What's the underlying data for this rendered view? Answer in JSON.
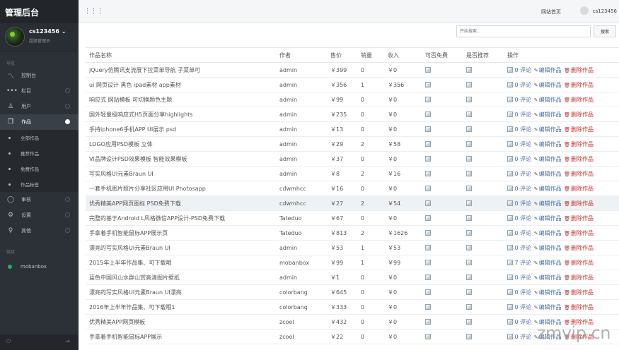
{
  "brand": "管理后台",
  "user": {
    "name": "cs123456",
    "role": "超级管理员"
  },
  "nav_section": "导航",
  "nav": [
    {
      "icon": "chart-icon",
      "glyph": "〽",
      "label": "控制台",
      "active": false,
      "bullet": false
    },
    {
      "icon": "more-icon",
      "glyph": "•••",
      "label": "栏目",
      "active": false,
      "bullet": true
    },
    {
      "icon": "user-icon",
      "glyph": "♙",
      "label": "用户",
      "active": false,
      "bullet": true
    },
    {
      "icon": "works-icon",
      "glyph": "❐",
      "label": "作品",
      "active": true,
      "bullet": true
    }
  ],
  "sub_items": [
    "全部作品",
    "推荐作品",
    "免费作品",
    "作品标签"
  ],
  "nav2": [
    {
      "icon": "review-icon",
      "glyph": "◯",
      "label": "审核",
      "bullet": true
    },
    {
      "icon": "settings-icon",
      "glyph": "⚙",
      "label": "设置",
      "bullet": true
    },
    {
      "icon": "other-icon",
      "glyph": "♀",
      "label": "其他",
      "bullet": true
    }
  ],
  "friends_section": "链接",
  "friend": "mobanbox",
  "topbar": {
    "site_link": "网站首页",
    "username": "cs123456"
  },
  "search": {
    "placeholder": "开始搜索...",
    "button": "搜索"
  },
  "table": {
    "headers": [
      "作品名称",
      "作者",
      "售价",
      "销量",
      "收入",
      "可否免费",
      "是否推荐",
      "操作"
    ],
    "rows": [
      {
        "name": "jQuery仿腾讯支流展下拉菜单导航 子菜单可",
        "author": "admin",
        "price": "￥399",
        "sales": "0",
        "income": "￥0",
        "comments": "0",
        "highlight": false
      },
      {
        "name": "ui 网页设计 黑色 ipad素材 app素材",
        "author": "admin",
        "price": "￥356",
        "sales": "1",
        "income": "￥356",
        "comments": "0",
        "highlight": false
      },
      {
        "name": "响应式 网站模板 可切换颜色主题",
        "author": "admin",
        "price": "￥99",
        "sales": "0",
        "income": "￥0",
        "comments": "0",
        "highlight": false
      },
      {
        "name": "国外轻量级响应式H5页面分享highlights",
        "author": "admin",
        "price": "￥235",
        "sales": "0",
        "income": "￥0",
        "comments": "0",
        "highlight": false
      },
      {
        "name": "手持iphone6手机APP UI展示 psd",
        "author": "admin",
        "price": "￥13",
        "sales": "0",
        "income": "￥0",
        "comments": "0",
        "highlight": false
      },
      {
        "name": "LOGO应用PSD模板 立体",
        "author": "admin",
        "price": "￥29",
        "sales": "2",
        "income": "￥58",
        "comments": "0",
        "highlight": false
      },
      {
        "name": "VI品牌设计PSD效果模板 智能效果模板",
        "author": "admin",
        "price": "￥37",
        "sales": "0",
        "income": "￥0",
        "comments": "0",
        "highlight": false
      },
      {
        "name": "写实风格UI元素Braun UI",
        "author": "admin",
        "price": "￥8",
        "sales": "2",
        "income": "￥16",
        "comments": "0",
        "highlight": false
      },
      {
        "name": "一套手机图片照片分享社区应用UI Photosapp",
        "author": "cdwmhcc",
        "price": "￥16",
        "sales": "0",
        "income": "￥0",
        "comments": "0",
        "highlight": false
      },
      {
        "name": "优秀精美APP网页图标 PSD免费下载",
        "author": "cdwmhcc",
        "price": "￥27",
        "sales": "2",
        "income": "￥54",
        "comments": "0",
        "highlight": true
      },
      {
        "name": "完整的基于Android L风格微信APP设计-PSD免费下载",
        "author": "Tateduo",
        "price": "￥67",
        "sales": "0",
        "income": "￥0",
        "comments": "0",
        "highlight": false
      },
      {
        "name": "手拿着手机智能鼠标APP展示页",
        "author": "Tateduo",
        "price": "￥813",
        "sales": "2",
        "income": "￥1626",
        "comments": "0",
        "highlight": false
      },
      {
        "name": "漂亮的写实风格UI元素Braun UI",
        "author": "admin",
        "price": "￥53",
        "sales": "1",
        "income": "￥53",
        "comments": "0",
        "highlight": false
      },
      {
        "name": "2015年上半年作品集、可下载哦",
        "author": "mobanbox",
        "price": "￥99",
        "sales": "1",
        "income": "￥99",
        "comments": "7",
        "highlight": false
      },
      {
        "name": "蓝色中国风山水群山赏高清图片壁纸",
        "author": "admin",
        "price": "￥1",
        "sales": "0",
        "income": "￥0",
        "comments": "0",
        "highlight": false
      },
      {
        "name": "漂亮的写实风格UI元素Braun UI漂亮",
        "author": "colorbang",
        "price": "￥645",
        "sales": "0",
        "income": "￥0",
        "comments": "0",
        "highlight": false
      },
      {
        "name": "2016年上半年作品集、可下载哦1",
        "author": "colorbang",
        "price": "￥333",
        "sales": "0",
        "income": "￥0",
        "comments": "0",
        "highlight": false
      },
      {
        "name": "优秀精美APP网页模板",
        "author": "zcool",
        "price": "￥432",
        "sales": "0",
        "income": "￥0",
        "comments": "0",
        "highlight": false
      },
      {
        "name": "手拿着手机智能鼠标APP展示",
        "author": "zcool",
        "price": "￥22",
        "sales": "0",
        "income": "￥0",
        "comments": "0",
        "highlight": false
      }
    ],
    "ops": {
      "comment_label": "评论",
      "edit_label": "编辑作品",
      "delete_label": "删除作品"
    }
  },
  "watermark": "zmvip.cn",
  "colors": {
    "sidebar": "#2c3137",
    "link": "#4a6fa5",
    "delete": "#c9302c"
  }
}
